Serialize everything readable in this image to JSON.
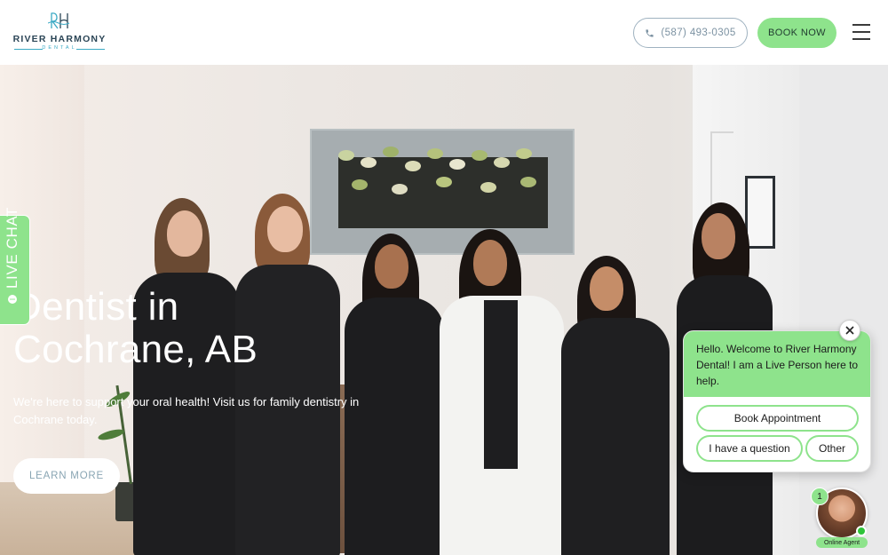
{
  "header": {
    "logo": {
      "name": "RIVER HARMONY",
      "sub": "DENTAL"
    },
    "phone": "(587) 493-0305",
    "book_label": "BOOK NOW",
    "icons": [
      "phone-icon",
      "menu-icon"
    ]
  },
  "hero": {
    "title_line1": "Dentist in",
    "title_line2": "Cochrane, AB",
    "description": "We're here to support your oral health! Visit us for family dentistry in Cochrane today.",
    "cta_label": "LEARN MORE"
  },
  "live_chat_tab": {
    "label": "LIVE CHAT",
    "icon": "chat-bubble-icon"
  },
  "chat_widget": {
    "message": "Hello. Welcome to River Harmony Dental! I am a Live Person here to help.",
    "options": [
      "Book Appointment",
      "I have a question",
      "Other"
    ],
    "close_icon": "close-icon",
    "badge_count": "1",
    "agent_label": "Online Agent"
  },
  "colors": {
    "accent_green": "#8ee38c",
    "logo_navy": "#2b4556",
    "logo_teal": "#3aa9c4",
    "online_green": "#2fc43a"
  }
}
